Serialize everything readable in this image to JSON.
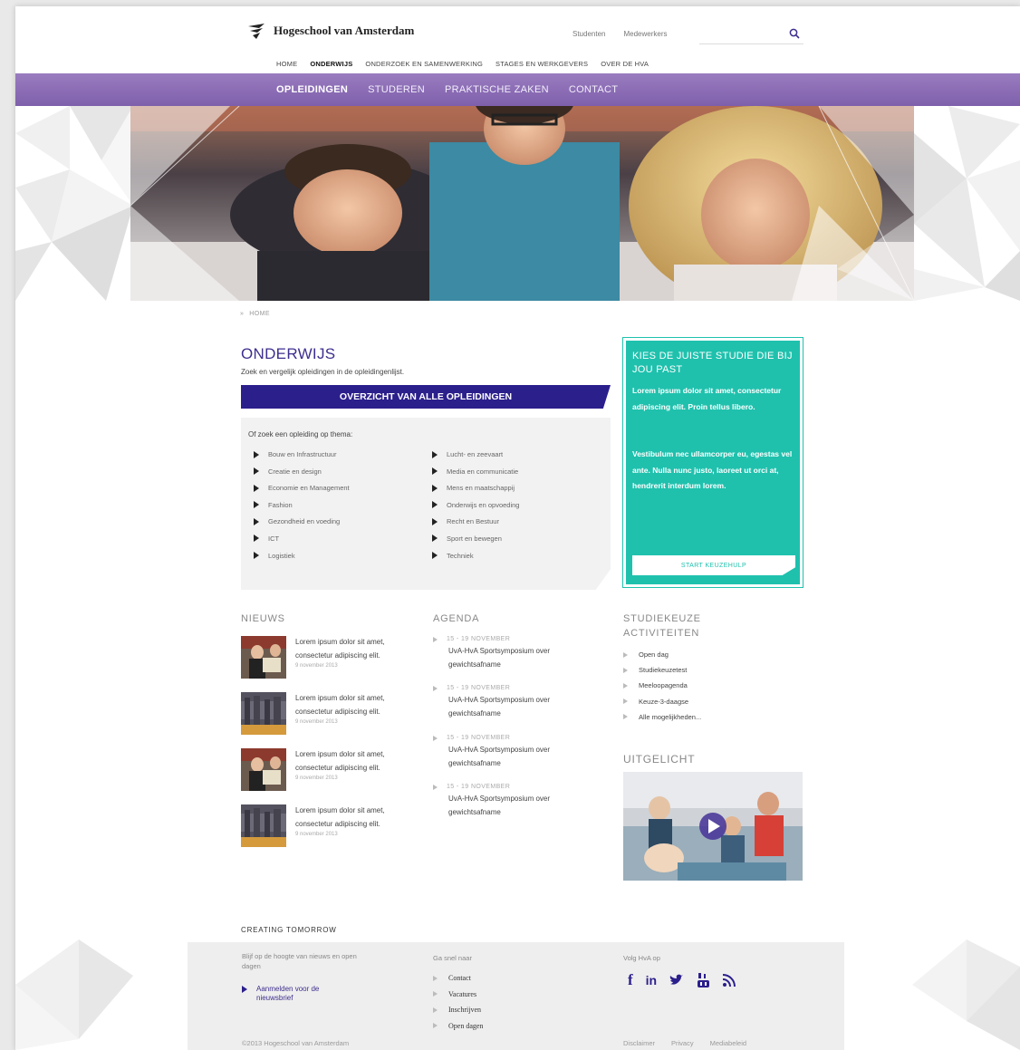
{
  "brand": {
    "name": "Hogeschool van Amsterdam",
    "accent": "#7e5fab",
    "teal": "#1fc1ad",
    "navy": "#2b1f8c"
  },
  "top_links": [
    "Studenten",
    "Medewerkers"
  ],
  "search": {
    "placeholder": "",
    "icon": "search-icon"
  },
  "main_nav": [
    "HOME",
    "ONDERWIJS",
    "ONDERZOEK EN SAMENWERKING",
    "STAGES EN WERKGEVERS",
    "OVER DE HVA"
  ],
  "main_nav_active": "ONDERWIJS",
  "sub_nav": [
    "OPLEIDINGEN",
    "STUDEREN",
    "PRAKTISCHE ZAKEN",
    "CONTACT"
  ],
  "sub_nav_active": "OPLEIDINGEN",
  "breadcrumb": {
    "separator": "»",
    "home": "HOME"
  },
  "onderwijs": {
    "title": "ONDERWIJS",
    "subtitle": "Zoek en vergelijk opleidingen in de opleidingenlijst.",
    "cta": "OVERZICHT VAN ALLE OPLEIDINGEN",
    "theme_title": "Of zoek een opleiding op thema:",
    "themes_left": [
      "Bouw en Infrastructuur",
      "Creatie en design",
      "Economie en Management",
      "Fashion",
      "Gezondheid en voeding",
      "ICT",
      "Logistiek"
    ],
    "themes_right": [
      "Lucht- en zeevaart",
      "Media en communicatie",
      "Mens en maatschappij",
      "Onderwijs en opvoeding",
      "Recht en Bestuur",
      "Sport en bewegen",
      "Techniek"
    ]
  },
  "studiekeuze_box": {
    "title": "KIES DE JUISTE STUDIE DIE BIJ JOU PAST",
    "p1": "Lorem ipsum dolor sit amet, consectetur adipiscing elit. Proin tellus libero.",
    "p2": "Vestibulum nec ullamcorper eu, egestas vel ante. Nulla nunc justo, laoreet ut orci at, hendrerit interdum lorem.",
    "button": "START KEUZEHULP"
  },
  "nieuws": {
    "heading": "NIEUWS",
    "items": [
      {
        "text": "Lorem ipsum dolor sit amet, consectetur adipiscing elit.",
        "date": "9 november 2013"
      },
      {
        "text": "Lorem ipsum dolor sit amet, consectetur adipiscing elit.",
        "date": "9 november 2013"
      },
      {
        "text": "Lorem ipsum dolor sit amet, consectetur adipiscing elit.",
        "date": "9 november 2013"
      },
      {
        "text": "Lorem ipsum dolor sit amet, consectetur adipiscing elit.",
        "date": "9 november 2013"
      }
    ]
  },
  "agenda": {
    "heading": "AGENDA",
    "items": [
      {
        "date": "15 - 19 NOVEMBER",
        "text": "UvA-HvA Sportsymposium over gewichtsafname"
      },
      {
        "date": "15 - 19 NOVEMBER",
        "text": "UvA-HvA Sportsymposium over gewichtsafname"
      },
      {
        "date": "15 - 19 NOVEMBER",
        "text": "UvA-HvA Sportsymposium over gewichtsafname"
      },
      {
        "date": "15 - 19 NOVEMBER",
        "text": "UvA-HvA Sportsymposium over gewichtsafname"
      }
    ]
  },
  "activiteiten": {
    "heading": "STUDIEKEUZE ACTIVITEITEN",
    "items": [
      "Open dag",
      "Studiekeuzetest",
      "Meeloopagenda",
      "Keuze-3-daagse",
      "Alle mogelijkheden..."
    ]
  },
  "uitgelicht": {
    "heading": "UITGELICHT",
    "icon": "play-icon"
  },
  "footer": {
    "tagline": "CREATING TOMORROW",
    "newsletter_text": "Blijf op de hoogte van nieuws en open dagen",
    "newsletter_link": "Aanmelden voor de nieuwsbrief",
    "goto_heading": "Ga snel naar",
    "goto_links": [
      "Contact",
      "Vacatures",
      "Inschrijven",
      "Open dagen"
    ],
    "follow_heading": "Volg HvA op",
    "socials": [
      "facebook-icon",
      "linkedin-icon",
      "twitter-icon",
      "youtube-icon",
      "rss-icon"
    ],
    "copyright": "©2013 Hogeschool van Amsterdam",
    "legal": [
      "Disclaimer",
      "Privacy",
      "Mediabeleid"
    ]
  }
}
